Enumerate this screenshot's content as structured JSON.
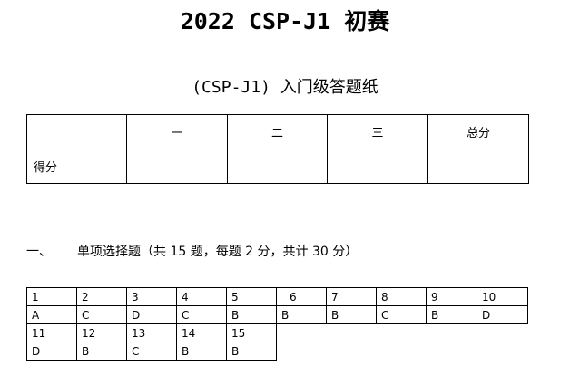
{
  "title": "2022 CSP-J1 初赛",
  "subtitle": "(CSP-J1) 入门级答题纸",
  "score_table": {
    "headers": [
      "",
      "一",
      "二",
      "三",
      "总分"
    ],
    "row_label": "得分"
  },
  "section": {
    "number": "一、",
    "heading": "单项选择题（共 15 题，每题 2 分，共计 30 分）"
  },
  "answers": {
    "row1_numbers": [
      "1",
      "2",
      "3",
      "4",
      "5",
      "6",
      "7",
      "8",
      "9",
      "10"
    ],
    "row1_answers": [
      "A",
      "C",
      "D",
      "C",
      "B",
      "B",
      "B",
      "C",
      "B",
      "D"
    ],
    "row2_numbers": [
      "11",
      "12",
      "13",
      "14",
      "15"
    ],
    "row2_answers": [
      "D",
      "B",
      "C",
      "B",
      "B"
    ]
  }
}
